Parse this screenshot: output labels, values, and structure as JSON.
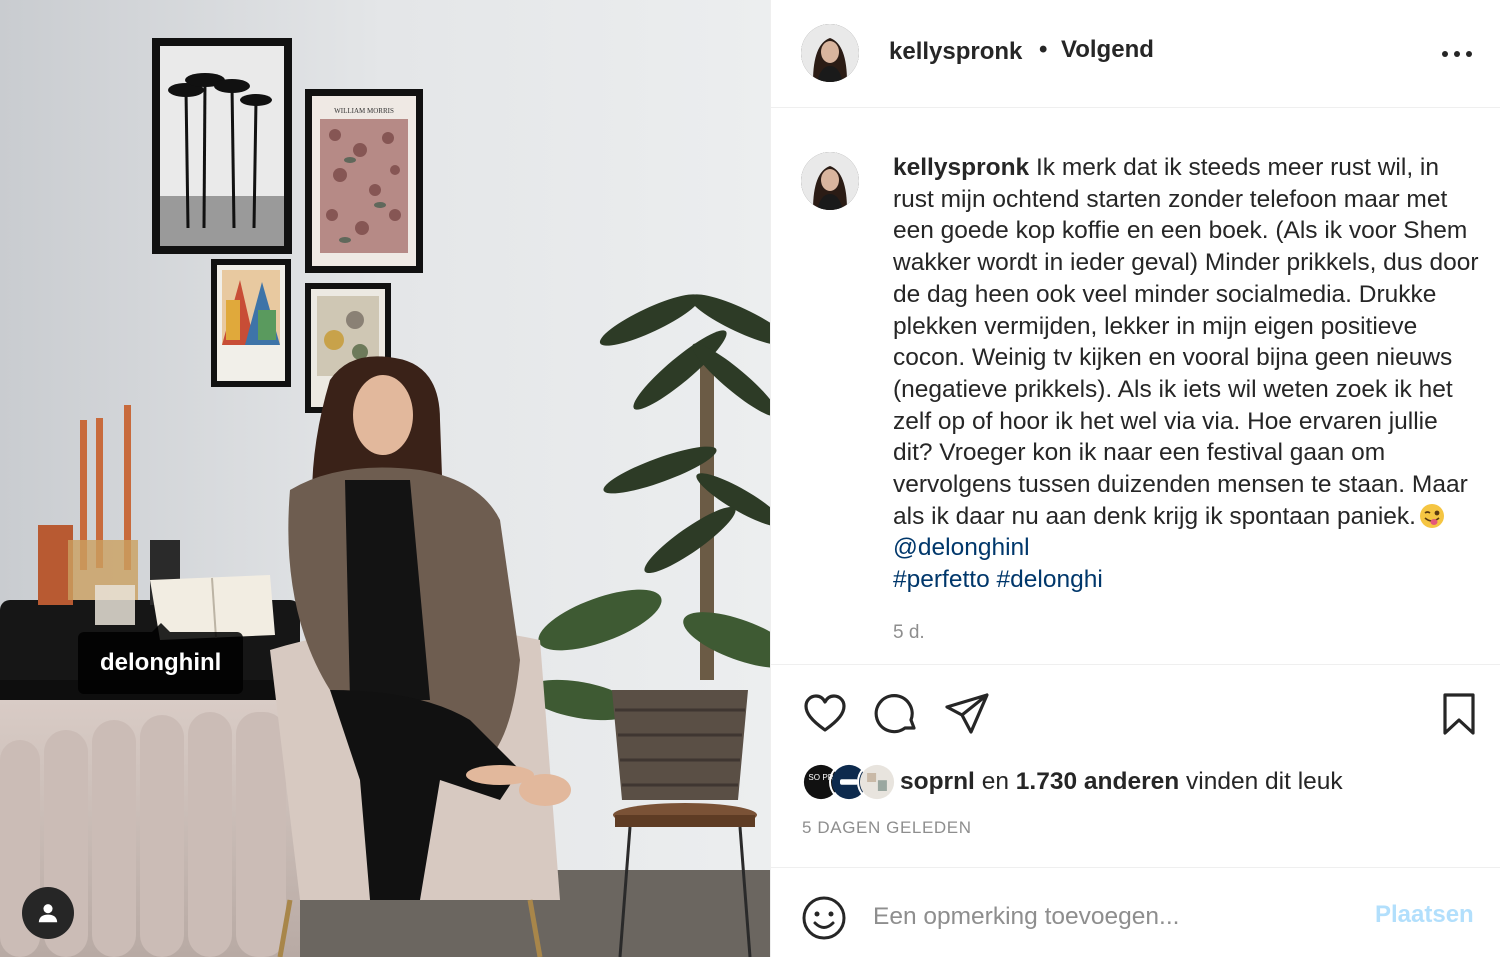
{
  "photo": {
    "tag_label": "delonghinl",
    "poster_text": "WILLIAM MORRIS"
  },
  "header": {
    "username": "kellyspronk",
    "separator": "•",
    "follow_label": "Volgend"
  },
  "caption": {
    "username": "kellyspronk",
    "text": "Ik merk dat ik steeds meer rust wil, in rust mijn ochtend starten zonder telefoon maar met een goede kop koffie en een boek. (Als ik voor Shem wakker wordt in ieder geval) Minder prikkels, dus door de dag heen ook veel minder socialmedia. Drukke plekken vermijden, lekker in mijn eigen positieve cocon. Weinig tv kijken en vooral bijna geen nieuws (negatieve prikkels). Als ik iets wil weten zoek ik het zelf op of hoor ik het wel via via. Hoe ervaren jullie dit? Vroeger kon ik naar een festival gaan om vervolgens tussen duizenden mensen te staan. Maar als ik daar nu aan denk krijg ik spontaan paniek.",
    "emoji": "winking-face-with-tongue",
    "mention": "@delonghinl",
    "hashtag_1": "#perfetto",
    "hashtag_2": "#delonghi",
    "time": "5 d."
  },
  "actions": {
    "icons": [
      "heart-icon",
      "comment-icon",
      "share-icon",
      "bookmark-icon"
    ]
  },
  "likes": {
    "first_liker": "soprnl",
    "connector": "en",
    "count_text": "1.730 anderen",
    "suffix": "vinden dit leuk",
    "liker_avatar_1_text": "SO PR"
  },
  "date_upper": "5 DAGEN GELEDEN",
  "comment": {
    "placeholder": "Een opmerking toevoegen...",
    "post_label": "Plaatsen"
  },
  "colors": {
    "link": "#00376b",
    "post_disabled": "#b2dffc",
    "muted": "#8e8e8e",
    "text": "#262626"
  }
}
